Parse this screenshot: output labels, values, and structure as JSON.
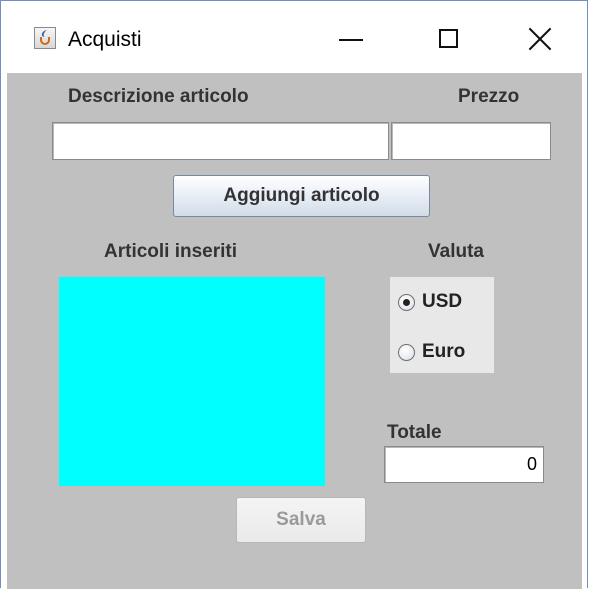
{
  "window": {
    "title": "Acquisti",
    "icon": "java-cup-icon",
    "controls": {
      "minimize": "minimize-icon",
      "maximize": "maximize-icon",
      "close": "close-icon"
    }
  },
  "form": {
    "description_label": "Descrizione articolo",
    "price_label": "Prezzo",
    "description_value": "",
    "price_value": "",
    "add_button": "Aggiungi articolo",
    "items_label": "Articoli inseriti",
    "currency_label": "Valuta",
    "currency_options": [
      {
        "label": "USD",
        "selected": true
      },
      {
        "label": "Euro",
        "selected": false
      }
    ],
    "total_label": "Totale",
    "total_value": "0",
    "save_button": "Salva",
    "list_color": "#00ffff",
    "panel_color": "#c0c0c0"
  }
}
